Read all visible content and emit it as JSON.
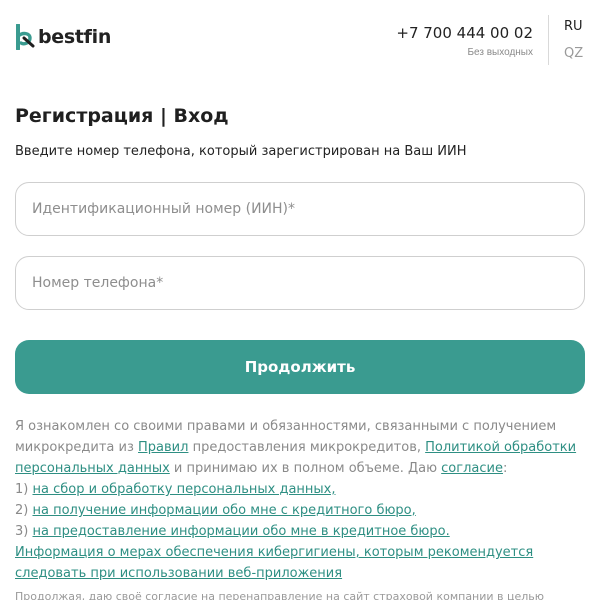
{
  "header": {
    "logo_text": "bestfin",
    "phone_number": "+7 700 444 00 02",
    "phone_hours": "Без выходных",
    "lang_ru": "RU",
    "lang_qz": "QZ"
  },
  "form": {
    "title": "Регистрация | Вход",
    "subtitle": "Введите номер телефона, который зарегистрирован на Ваш ИИН",
    "iin_placeholder": "Идентификационный номер (ИИН)*",
    "phone_placeholder": "Номер телефона*",
    "submit_label": "Продолжить"
  },
  "legal": {
    "l1": "Я ознакомлен со своими правами и обязанностями, связанными с получением",
    "l2_a": "микрокредита из ",
    "l2_link1": "Правил",
    "l2_b": " предоставления микрокредитов, ",
    "l2_link2": "Политикой обработки",
    "l3_link": "персональных данных",
    "l3_b": " и принимаю их в полном объеме. Даю ",
    "l3_link2": "согласие",
    "l3_c": ":",
    "item1_num": "1) ",
    "item1_link": "на сбор и обработку персональных данных,",
    "item2_num": "2) ",
    "item2_link": "на получение информации обо мне с кредитного бюро,",
    "item3_num": "3) ",
    "item3_link": "на предоставление информации обо мне в кредитное бюро.",
    "cyber_link_1": "Информация о мерах обеспечения кибергигиены, которым рекомендуется",
    "cyber_link_2": "следовать при использовании веб-приложения",
    "footer_partial": "Продолжая, даю своё согласие на перенаправление на сайт страховой компании в целью"
  },
  "colors": {
    "accent": "#3a9b90",
    "link": "#2e8f83",
    "muted": "#8a8a8a"
  }
}
